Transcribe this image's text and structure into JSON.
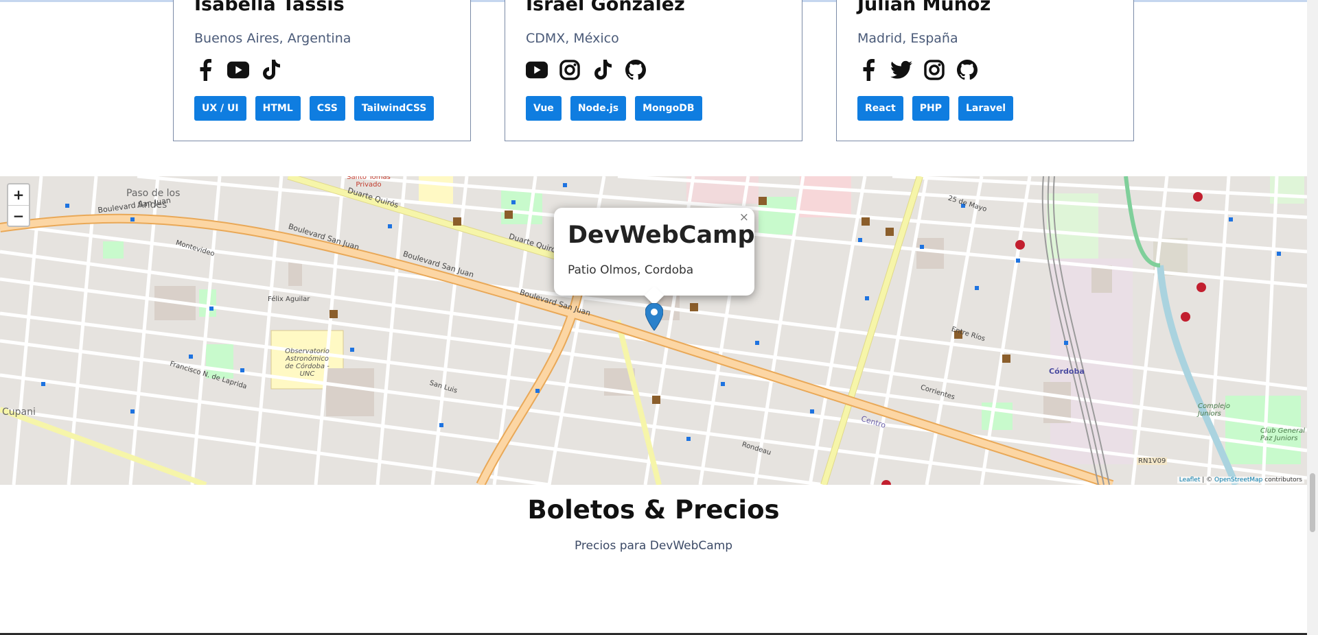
{
  "speakers": [
    {
      "name": "Isabella Tassis",
      "location": "Buenos Aires, Argentina",
      "socials": [
        "facebook-icon",
        "youtube-icon",
        "tiktok-icon"
      ],
      "tags": [
        "UX / UI",
        "HTML",
        "CSS",
        "TailwindCSS"
      ]
    },
    {
      "name": "Israel González",
      "location": "CDMX, México",
      "socials": [
        "youtube-icon",
        "instagram-icon",
        "tiktok-icon",
        "github-icon"
      ],
      "tags": [
        "Vue",
        "Node.js",
        "MongoDB"
      ]
    },
    {
      "name": "Julián Muñoz",
      "location": "Madrid, España",
      "socials": [
        "facebook-icon",
        "twitter-icon",
        "instagram-icon",
        "github-icon"
      ],
      "tags": [
        "React",
        "PHP",
        "Laravel"
      ]
    }
  ],
  "map": {
    "zoom_in": "+",
    "zoom_out": "−",
    "popup": {
      "title": "DevWebCamp",
      "address": "Patio Olmos, Cordoba",
      "close": "×"
    },
    "attribution": {
      "leaflet": "Leaflet",
      "separator": " | © ",
      "osm": "OpenStreetMap",
      "suffix": " contributors"
    },
    "labels": {
      "paso": "Paso de los",
      "andes": "Andes",
      "boulevard1": "Boulevard San Juan",
      "boulevard2": "Boulevard San Juan",
      "boulevard3": "Boulevard San Juan",
      "boulevard4": "Boulevard San Juan",
      "duarte1": "Duarte Quirós",
      "duarte2": "Duarte Quirós",
      "felix": "Félix Aguilar",
      "montevideo": "Montevideo",
      "observatorio": "Observatorio Astronómico de Córdoba - UNC",
      "cordoba": "Córdoba",
      "centro": "Centro",
      "rn1v09": "RN1V09",
      "mayo": "25 de Mayo",
      "entre": "Entre Ríos",
      "corrientes": "Corrientes",
      "sanluis": "San Luis",
      "rondeau": "Rondeau",
      "lanrida": "Francisco N. de Laprida",
      "cupani": "Cupani",
      "complejo": "Complejo Juniors",
      "club": "Club General Paz Juniors",
      "santo": "Santo Tomás Privado"
    }
  },
  "tickets": {
    "title": "Boletos & Precios",
    "subtitle": "Precios para DevWebCamp"
  },
  "colors": {
    "tag_bg": "#0f7de0",
    "card_border": "#7a8aa6",
    "main_road": "#f7cf8c",
    "secondary_road": "#f6f5a9",
    "map_bg": "#e6e3df",
    "marker": "#2a81cb"
  }
}
